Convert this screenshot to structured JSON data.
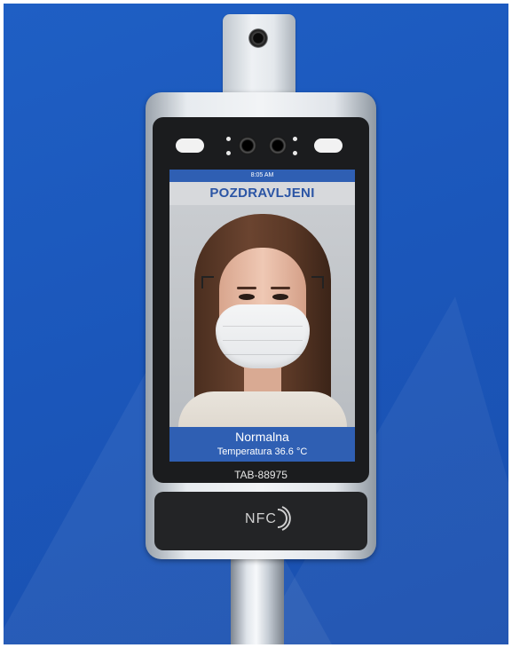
{
  "screen": {
    "time": "8:05 AM",
    "greeting": "POZDRAVLJENI",
    "result_title": "Normalna",
    "result_temperature": "Temperatura 36.6 °C",
    "header_color": "#2f5fb3"
  },
  "device": {
    "model": "TAB-88975",
    "nfc_label": "NFC"
  },
  "icons": {
    "nfc": "nfc-icon",
    "top_camera": "camera-icon"
  }
}
